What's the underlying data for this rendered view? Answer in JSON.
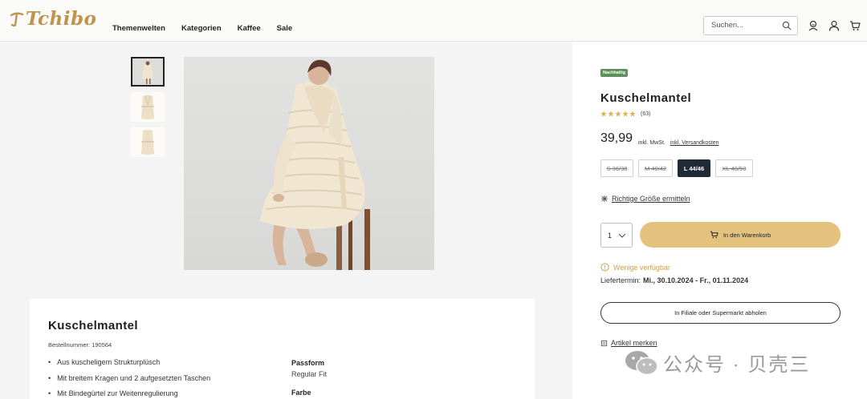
{
  "header": {
    "logo_text": "Tchibo",
    "nav": [
      "Themenwelten",
      "Kategorien",
      "Kaffee",
      "Sale"
    ],
    "search_placeholder": "Suchen...",
    "icons": [
      "search-icon",
      "account-smile-icon",
      "user-icon",
      "cart-icon"
    ]
  },
  "gallery": {
    "thumbnails": [
      "thumbnail-model",
      "thumbnail-front",
      "thumbnail-back"
    ],
    "selected_index": 0
  },
  "product": {
    "badge": "Nachhaltig",
    "title": "Kuschelmantel",
    "rating_stars": 5,
    "rating_count": "(63)",
    "price": "39,99",
    "tax_note": "inkl. MwSt.",
    "shipping_link": "inkl. Versandkosten",
    "sizes": [
      {
        "label": "S 36/38",
        "available": false,
        "selected": false
      },
      {
        "label": "M 40/42",
        "available": false,
        "selected": false
      },
      {
        "label": "L 44/46",
        "available": true,
        "selected": true
      },
      {
        "label": "XL 48/50",
        "available": false,
        "selected": false
      }
    ],
    "size_help": "Richtige Größe ermitteln",
    "quantity": "1",
    "cart_button": "In den Warenkorb",
    "availability": "Wenige verfügbar",
    "delivery_label": "Liefertermin:",
    "delivery_dates": "Mi., 30.10.2024 - Fr., 01.11.2024",
    "pickup_button": "In Filiale oder Supermarkt abholen",
    "wishlist_link": "Artikel merken"
  },
  "description": {
    "title": "Kuschelmantel",
    "order_number": "Bestellnummer: 190564",
    "bullets": [
      "Aus kuscheligem Strukturplüsch",
      "Mit breitem Kragen und 2 aufgesetzten Taschen",
      "Mit Bindegürtel zur Weitenregulierung"
    ],
    "attributes": [
      {
        "key": "Passform",
        "value": "Regular Fit"
      },
      {
        "key": "Farbe",
        "value": ""
      }
    ]
  },
  "watermark": "公众号 · 贝壳三",
  "colors": {
    "brand": "#c0924b",
    "cart_button": "#e3c27e",
    "selected_size": "#1f2a36",
    "badge": "#5f8f5a",
    "availability": "#d7a042"
  }
}
